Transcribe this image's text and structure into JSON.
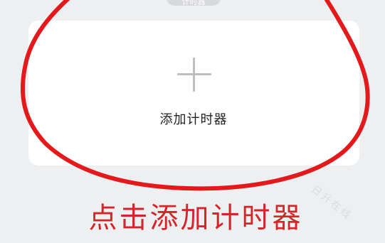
{
  "top_chip": {
    "label": "计时器"
  },
  "add_card": {
    "plus_icon": "plus-icon",
    "label": "添加计时器"
  },
  "annotation": {
    "caption": "点击添加计时器",
    "stroke_color": "#e3191c"
  },
  "watermark": {
    "text": "日升在线"
  }
}
